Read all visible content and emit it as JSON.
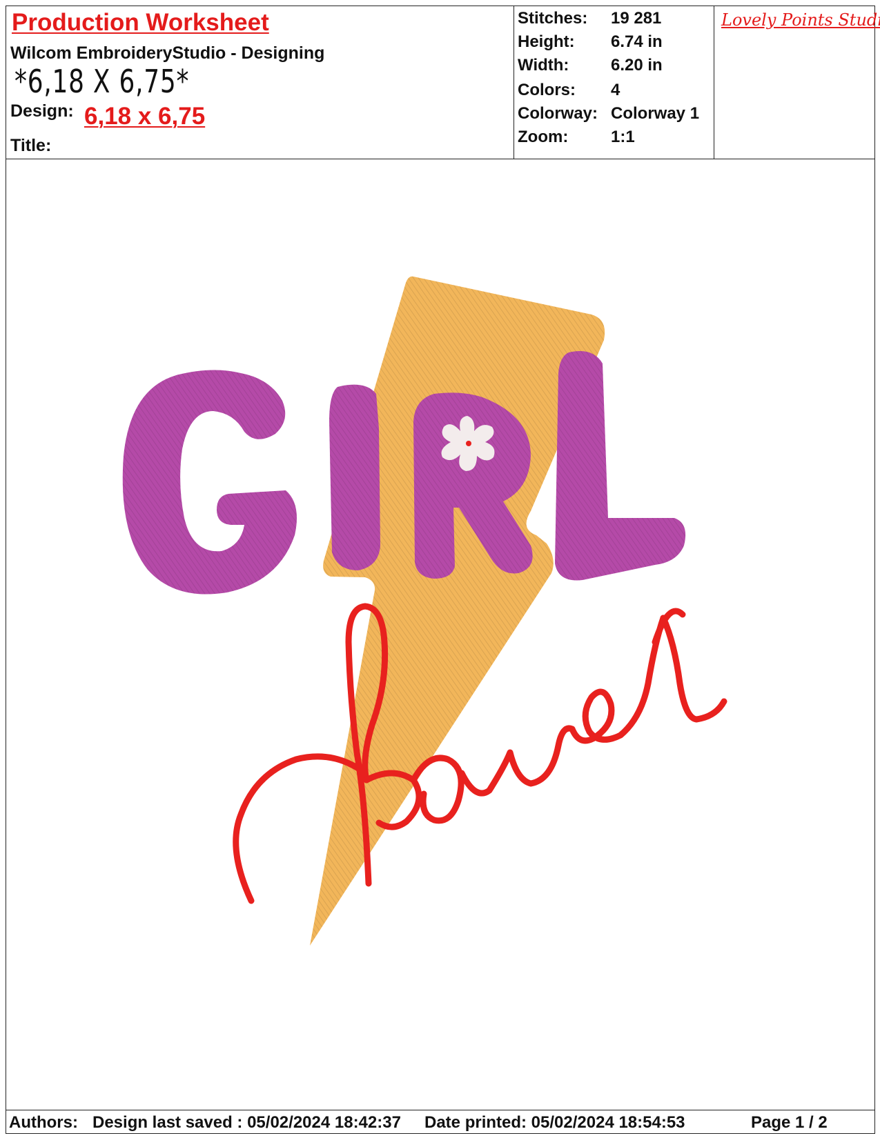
{
  "header": {
    "title": "Production Worksheet",
    "software": "Wilcom EmbroideryStudio - Designing",
    "size_text": "*6,18 X 6,75*",
    "design_label": "Design:",
    "design_value": "6,18 x 6,75",
    "title_label": "Title:"
  },
  "stats": [
    {
      "label": "Stitches:",
      "value": "19 281"
    },
    {
      "label": "Height:",
      "value": "6.74 in"
    },
    {
      "label": "Width:",
      "value": "6.20 in"
    },
    {
      "label": "Colors:",
      "value": "4"
    },
    {
      "label": "Colorway:",
      "value": "Colorway 1"
    },
    {
      "label": "Zoom:",
      "value": "1:1"
    }
  ],
  "studio": "Lovely Points Studio",
  "design_colors": {
    "bolt": "#f2b65a",
    "letters": "#b54aa8",
    "script": "#e8211e",
    "flower": "#f3ecec"
  },
  "footer": {
    "authors": "Authors:",
    "last_saved": "Design last saved : 05/02/2024 18:42:37",
    "printed": "Date printed: 05/02/2024 18:54:53",
    "page": "Page 1 / 2"
  }
}
